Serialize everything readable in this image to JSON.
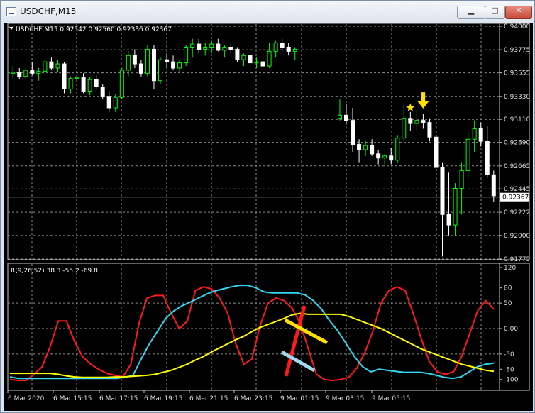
{
  "window": {
    "title": "USDCHF,M15",
    "minimize_label": "▁",
    "maximize_label": "□",
    "close_label": "✕"
  },
  "main_chart": {
    "header_symbol": "USDCHF,M15",
    "header_ohlc": "0.92542 0.92560 0.92336 0.92367",
    "price_ticks": [
      "0.94000",
      "0.93775",
      "0.93555",
      "0.93330",
      "0.93110",
      "0.92890",
      "0.92665",
      "0.92445",
      "0.92222",
      "0.92000",
      "0.91775"
    ],
    "current_price": "0.92367",
    "colors": {
      "bull": "#00ff00",
      "bear": "#ffffff",
      "grid": "#8c8c8c",
      "price_line": "#9a9a9a",
      "arrow": "#ffe000",
      "star": "#ffe000"
    }
  },
  "chart_data": [
    {
      "type": "candlestick",
      "title": "USDCHF,M15",
      "ylim": [
        0.91775,
        0.94
      ],
      "current_price": 0.92367,
      "ohlc": [
        [
          0.9355,
          0.9362,
          0.935,
          0.9356
        ],
        [
          0.9356,
          0.936,
          0.9349,
          0.9352
        ],
        [
          0.9352,
          0.936,
          0.9349,
          0.9358
        ],
        [
          0.9358,
          0.9366,
          0.9353,
          0.9355
        ],
        [
          0.9355,
          0.936,
          0.9348,
          0.9357
        ],
        [
          0.9357,
          0.9368,
          0.9353,
          0.9366
        ],
        [
          0.9366,
          0.937,
          0.9358,
          0.936
        ],
        [
          0.936,
          0.9368,
          0.9356,
          0.9364
        ],
        [
          0.9364,
          0.9366,
          0.9336,
          0.934
        ],
        [
          0.934,
          0.9352,
          0.9336,
          0.935
        ],
        [
          0.935,
          0.9356,
          0.9345,
          0.9351
        ],
        [
          0.9351,
          0.9355,
          0.9336,
          0.9338
        ],
        [
          0.9338,
          0.9352,
          0.9334,
          0.9349
        ],
        [
          0.9349,
          0.9353,
          0.934,
          0.9342
        ],
        [
          0.9342,
          0.9345,
          0.933,
          0.9333
        ],
        [
          0.9333,
          0.9338,
          0.9318,
          0.9322
        ],
        [
          0.9322,
          0.9335,
          0.9318,
          0.9332
        ],
        [
          0.9332,
          0.936,
          0.933,
          0.9358
        ],
        [
          0.9358,
          0.9376,
          0.9352,
          0.9372
        ],
        [
          0.9372,
          0.9378,
          0.936,
          0.9364
        ],
        [
          0.9364,
          0.9368,
          0.9352,
          0.9355
        ],
        [
          0.9355,
          0.9382,
          0.9352,
          0.9378
        ],
        [
          0.9378,
          0.9382,
          0.934,
          0.9348
        ],
        [
          0.9348,
          0.937,
          0.9345,
          0.9368
        ],
        [
          0.9368,
          0.9374,
          0.936,
          0.9366
        ],
        [
          0.9366,
          0.9372,
          0.9358,
          0.936
        ],
        [
          0.936,
          0.9368,
          0.9356,
          0.9365
        ],
        [
          0.9365,
          0.9382,
          0.9362,
          0.938
        ],
        [
          0.938,
          0.9388,
          0.937,
          0.9383
        ],
        [
          0.9383,
          0.9388,
          0.9374,
          0.9378
        ],
        [
          0.9378,
          0.9384,
          0.9372,
          0.938
        ],
        [
          0.938,
          0.9386,
          0.9375,
          0.9383
        ],
        [
          0.9383,
          0.9388,
          0.9376,
          0.9377
        ],
        [
          0.9377,
          0.9382,
          0.937,
          0.938
        ],
        [
          0.938,
          0.9384,
          0.9374,
          0.9378
        ],
        [
          0.9378,
          0.938,
          0.9366,
          0.9368
        ],
        [
          0.9368,
          0.9374,
          0.9362,
          0.9372
        ],
        [
          0.9372,
          0.9376,
          0.9362,
          0.9365
        ],
        [
          0.9365,
          0.937,
          0.936,
          0.9366
        ],
        [
          0.9366,
          0.937,
          0.936,
          0.9362
        ],
        [
          0.9362,
          0.9384,
          0.936,
          0.9376
        ],
        [
          0.9376,
          0.9386,
          0.937,
          0.9384
        ],
        [
          0.9384,
          0.9388,
          0.9376,
          0.938
        ],
        [
          0.938,
          0.9384,
          0.9372,
          0.9376
        ],
        [
          0.9376,
          0.938,
          0.9368,
          0.9378
        ],
        null,
        null,
        null,
        null,
        null,
        null,
        [
          0.9312,
          0.933,
          0.931,
          0.9315
        ],
        [
          0.9315,
          0.9326,
          0.9306,
          0.931
        ],
        [
          0.931,
          0.9322,
          0.928,
          0.9287
        ],
        [
          0.9287,
          0.9292,
          0.927,
          0.9282
        ],
        [
          0.9282,
          0.929,
          0.9276,
          0.9286
        ],
        [
          0.9286,
          0.9292,
          0.9276,
          0.9278
        ],
        [
          0.9278,
          0.9282,
          0.9268,
          0.9274
        ],
        [
          0.9274,
          0.9278,
          0.9268,
          0.9276
        ],
        [
          0.9276,
          0.9284,
          0.9268,
          0.9272
        ],
        [
          0.9272,
          0.9296,
          0.927,
          0.9293
        ],
        [
          0.9293,
          0.9325,
          0.929,
          0.9312
        ],
        [
          0.9312,
          0.9318,
          0.93,
          0.9307
        ],
        [
          0.9307,
          0.932,
          0.93,
          0.931
        ],
        [
          0.931,
          0.9316,
          0.9302,
          0.9308
        ],
        [
          0.9308,
          0.9312,
          0.929,
          0.9294
        ],
        [
          0.9294,
          0.93,
          0.926,
          0.9265
        ],
        [
          0.9265,
          0.927,
          0.918,
          0.922
        ],
        [
          0.922,
          0.926,
          0.92,
          0.921
        ],
        [
          0.921,
          0.925,
          0.92,
          0.9245
        ],
        [
          0.9245,
          0.927,
          0.922,
          0.9262
        ],
        [
          0.9262,
          0.93,
          0.9255,
          0.9292
        ],
        [
          0.9292,
          0.931,
          0.928,
          0.9302
        ],
        [
          0.9302,
          0.9308,
          0.9285,
          0.929
        ],
        [
          0.929,
          0.9305,
          0.9255,
          0.9258
        ],
        [
          0.9258,
          0.9262,
          0.9232,
          0.9238
        ]
      ],
      "signals": [
        {
          "type": "star",
          "index": 62
        },
        {
          "type": "down-arrow",
          "index": 64
        }
      ]
    },
    {
      "type": "line",
      "title": "R(9,26,52) 38.3 -55.2 -69.8",
      "ylim": [
        -120,
        120
      ],
      "y_ticks": [
        "120",
        "80",
        "50",
        "0.00",
        "-50",
        "-80",
        "-100"
      ],
      "x_labels": [
        "6 Mar 2020",
        "6 Mar 15:15",
        "6 Mar 17:15",
        "6 Mar 19:15",
        "6 Mar 21:15",
        "6 Mar 23:15",
        "9 Mar 01:15",
        "9 Mar 03:15",
        "9 Mar 05:15"
      ],
      "series": [
        {
          "color": "#ff1a1a",
          "values": [
            -100,
            -102,
            -102,
            -90,
            -75,
            -35,
            15,
            15,
            -25,
            -55,
            -70,
            -80,
            -88,
            -92,
            -95,
            -70,
            10,
            60,
            65,
            65,
            30,
            0,
            15,
            75,
            82,
            78,
            60,
            30,
            -30,
            -70,
            -60,
            5,
            50,
            60,
            55,
            40,
            10,
            -40,
            -90,
            -100,
            -102,
            -100,
            -96,
            -78,
            -48,
            -5,
            50,
            75,
            82,
            75,
            30,
            -20,
            -65,
            -85,
            -90,
            -85,
            -55,
            -10,
            35,
            55,
            38
          ]
        },
        {
          "color": "#32d6f0",
          "values": [
            -95,
            -98,
            -98,
            -98,
            -98,
            -98,
            -98,
            -98,
            -98,
            -98,
            -98,
            -98,
            -98,
            -98,
            -96,
            -92,
            -60,
            -30,
            -5,
            20,
            35,
            45,
            52,
            60,
            68,
            74,
            78,
            82,
            85,
            85,
            80,
            72,
            70,
            70,
            70,
            70,
            66,
            55,
            38,
            15,
            -5,
            -30,
            -55,
            -75,
            -85,
            -80,
            -82,
            -84,
            -86,
            -86,
            -86,
            -88,
            -92,
            -96,
            -98,
            -95,
            -85,
            -75,
            -70,
            -68
          ]
        },
        {
          "color": "#ffff00",
          "values": [
            -88,
            -88,
            -88,
            -88,
            -88,
            -88,
            -90,
            -93,
            -95,
            -96,
            -96,
            -96,
            -96,
            -95,
            -95,
            -94,
            -93,
            -92,
            -90,
            -86,
            -82,
            -76,
            -70,
            -62,
            -55,
            -46,
            -38,
            -30,
            -22,
            -15,
            -6,
            2,
            8,
            14,
            20,
            27,
            30,
            28,
            28,
            28,
            28,
            28,
            24,
            18,
            12,
            6,
            0,
            -8,
            -16,
            -24,
            -32,
            -40,
            -46,
            -52,
            -58,
            -64,
            -70,
            -74,
            -78,
            -82,
            -84
          ]
        }
      ],
      "annotations": [
        {
          "type": "red-thick-line"
        },
        {
          "type": "yellow-thick-line"
        },
        {
          "type": "lightblue-thick-line"
        }
      ]
    }
  ]
}
